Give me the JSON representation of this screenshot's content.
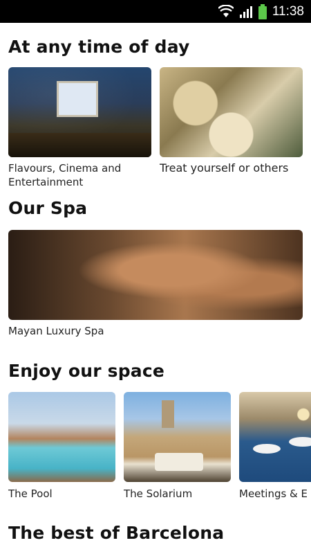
{
  "status_bar": {
    "time": "11:38",
    "icons": [
      "wifi-icon",
      "signal-icon",
      "battery-icon"
    ]
  },
  "sections": {
    "time_of_day": {
      "title": "At any time of day",
      "cards": [
        {
          "caption": "Flavours, Cinema and Entertainment"
        },
        {
          "caption": "Treat yourself or others"
        }
      ]
    },
    "spa": {
      "title": "Our Spa",
      "cards": [
        {
          "caption": "Mayan Luxury Spa"
        }
      ]
    },
    "space": {
      "title": "Enjoy our space",
      "cards": [
        {
          "caption": "The Pool"
        },
        {
          "caption": "The Solarium"
        },
        {
          "caption": "Meetings & E"
        }
      ]
    },
    "barcelona": {
      "title": "The best of Barcelona"
    }
  },
  "colors": {
    "status_bar_bg": "#000000",
    "battery": "#5cc84a",
    "page_bg": "#ffffff"
  }
}
